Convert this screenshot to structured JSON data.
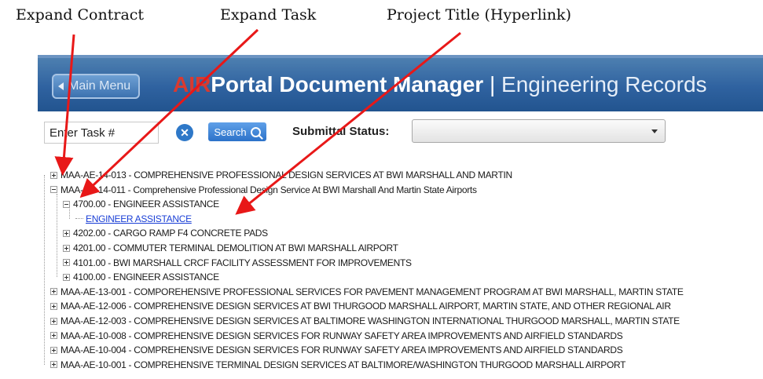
{
  "callouts": {
    "expand_contract": "Expand Contract",
    "expand_task": "Expand Task",
    "project_title": "Project Title (Hyperlink)"
  },
  "header": {
    "main_menu_label": "Main Menu",
    "title_air": "AIR",
    "title_portal": "Portal Document Manager",
    "title_separator": " | ",
    "title_section": "Engineering Records"
  },
  "toolbar": {
    "task_input_value": "Enter Task #",
    "search_label": "Search",
    "status_label": "Submittal Status:",
    "status_selected": ""
  },
  "tree": [
    {
      "label": "MAA-AE-14-013 - COMPREHENSIVE PROFESSIONAL DESIGN SERVICES AT BWI MARSHALL AND MARTIN",
      "level": 0,
      "expanded": false
    },
    {
      "label": "MAA-AE-14-011 - Comprehensive Professional Design Service At BWI Marshall And Martin State Airports",
      "level": 0,
      "expanded": true
    },
    {
      "label": "4700.00 - ENGINEER ASSISTANCE",
      "level": 1,
      "expanded": true
    },
    {
      "label": "ENGINEER ASSISTANCE",
      "level": 2,
      "link": true
    },
    {
      "label": "4202.00 - CARGO RAMP F4 CONCRETE PADS",
      "level": 1,
      "expanded": false
    },
    {
      "label": "4201.00 - COMMUTER TERMINAL DEMOLITION AT BWI MARSHALL AIRPORT",
      "level": 1,
      "expanded": false
    },
    {
      "label": "4101.00 - BWI MARSHALL CRCF FACILITY ASSESSMENT FOR IMPROVEMENTS",
      "level": 1,
      "expanded": false
    },
    {
      "label": "4100.00 - ENGINEER ASSISTANCE",
      "level": 1,
      "expanded": false
    },
    {
      "label": "MAA-AE-13-001 - COMPOREHENSIVE PROFESSIONAL SERVICES FOR PAVEMENT MANAGEMENT PROGRAM AT BWI MARSHALL, MARTIN STATE",
      "level": 0,
      "expanded": false
    },
    {
      "label": "MAA-AE-12-006 - COMPREHENSIVE DESIGN SERVICES AT BWI THURGOOD MARSHALL AIRPORT, MARTIN STATE, AND OTHER REGIONAL AIR",
      "level": 0,
      "expanded": false
    },
    {
      "label": "MAA-AE-12-003 - COMPREHENSIVE DESIGN SERVICES AT BALTIMORE WASHINGTON INTERNATIONAL THURGOOD MARSHALL, MARTIN STATE",
      "level": 0,
      "expanded": false
    },
    {
      "label": "MAA-AE-10-008 - COMPREHENSIVE DESIGN SERVICES FOR RUNWAY SAFETY AREA IMPROVEMENTS AND AIRFIELD STANDARDS",
      "level": 0,
      "expanded": false
    },
    {
      "label": "MAA-AE-10-004 - COMPREHENSIVE DESIGN SERVICES FOR RUNWAY SAFETY AREA IMPROVEMENTS AND AIRFIELD STANDARDS",
      "level": 0,
      "expanded": false
    },
    {
      "label": "MAA-AE-10-001 - COMPREHENSIVE TERMINAL DESIGN SERVICES AT BALTIMORE/WASHINGTON THURGOOD MARSHALL AIRPORT",
      "level": 0,
      "expanded": false
    }
  ],
  "colors": {
    "banner": "#2f62a0",
    "air_red": "#d93a30",
    "arrow_red": "#e81818",
    "link_blue": "#1a3fd6"
  }
}
